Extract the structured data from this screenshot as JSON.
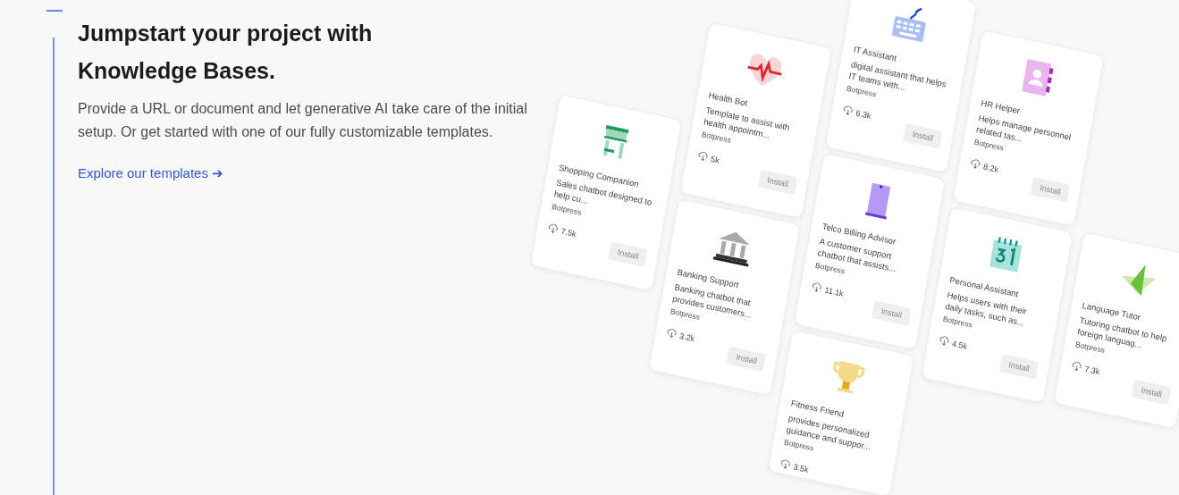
{
  "hero": {
    "title": "Jumpstart your project with Knowledge Bases.",
    "description": "Provide a URL or document and let generative AI take care of the initial setup. Or get started with one of our fully customizable templates.",
    "link": {
      "label": "Explore our templates",
      "arrow": "➔"
    }
  },
  "templates": [
    {
      "kind": "shopping",
      "title": "Shopping Companion",
      "description": "Sales chatbot designed to help cu...",
      "author": "Botpress",
      "downloads": "7.5k",
      "install": {
        "label": "Install",
        "disabled": true
      }
    },
    {
      "kind": "health",
      "title": "Health Bot",
      "description": "Template to assist with health appointm...",
      "author": "Botpress",
      "downloads": "5k",
      "install": {
        "label": "Install",
        "disabled": true
      }
    },
    {
      "kind": "bank",
      "title": "Banking Support",
      "description": "Banking chatbot that provides customers...",
      "author": "Botpress",
      "downloads": "3.2k",
      "install": {
        "label": "Install",
        "disabled": true
      }
    },
    {
      "kind": "keyboard",
      "title": "IT Assistant",
      "description": "digital assistant that helps IT teams with...",
      "author": "Botpress",
      "downloads": "6.3k",
      "install": {
        "label": "Install",
        "disabled": true
      }
    },
    {
      "kind": "phone",
      "title": "Telco Billing Advisor",
      "description": "A customer support chatbot that assists...",
      "author": "Botpress",
      "downloads": "11.1k",
      "install": {
        "label": "Install",
        "disabled": true
      }
    },
    {
      "kind": "trophy",
      "title": "Fitness Friend",
      "description": "provides personalized guidance and suppor...",
      "author": "Botpress",
      "downloads": "3.5k"
    },
    {
      "kind": "contacts",
      "title": "HR Helper",
      "description": "Helps manage personnel related tas...",
      "author": "Botpress",
      "downloads": "8.2k",
      "install": {
        "label": "Install",
        "disabled": true
      }
    },
    {
      "kind": "calendar",
      "title": "Personal Assistant",
      "description": "Helps users with their daily tasks, such as...",
      "author": "Botpress",
      "downloads": "4.5k",
      "install": {
        "label": "Install",
        "disabled": true
      }
    },
    {
      "kind": "star",
      "title": "Language Tutor",
      "description": "Tutoring chatbot to help foreign languag...",
      "author": "Botpress",
      "downloads": "7.3k",
      "install": {
        "label": "Install",
        "disabled": true
      }
    }
  ]
}
